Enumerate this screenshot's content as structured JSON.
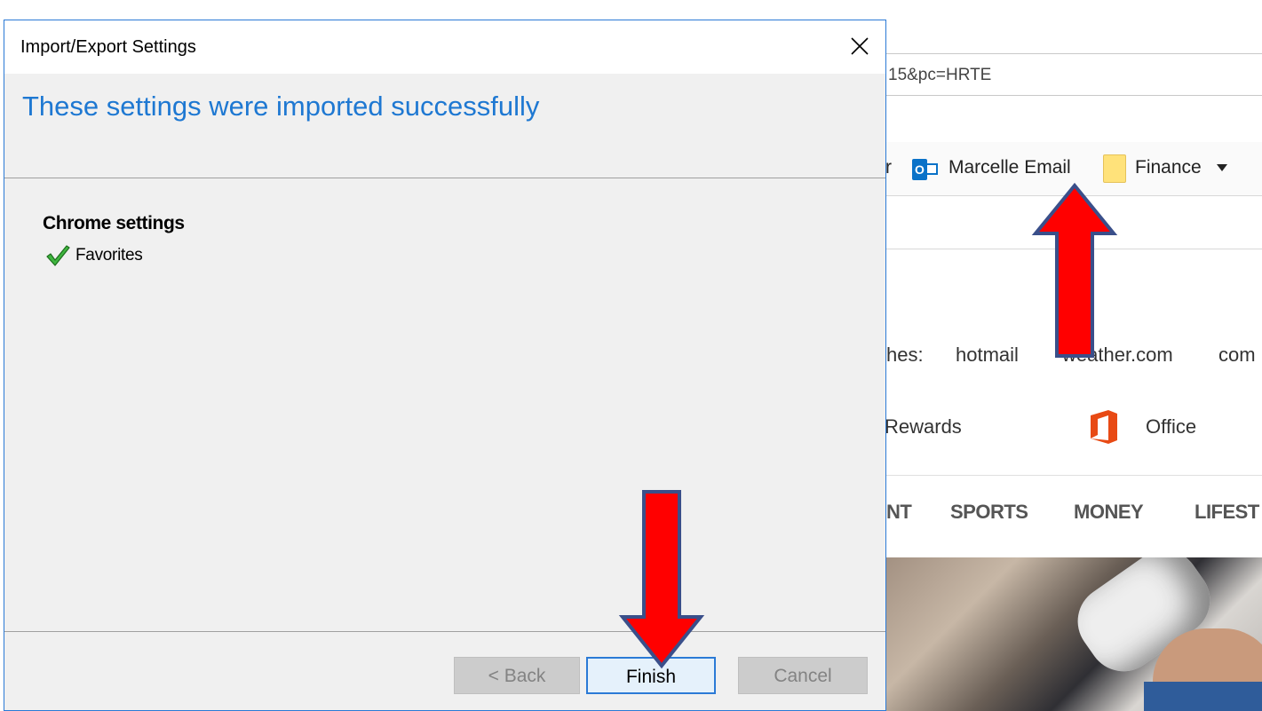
{
  "browser": {
    "address_fragment": "15&pc=HRTE",
    "favorites": {
      "partial_left": "r",
      "email_label": "Marcelle Email",
      "finance_label": "Finance"
    },
    "trending": {
      "partial_label": "hes:",
      "items": [
        "hotmail",
        "weather.com",
        "com"
      ]
    },
    "links": {
      "rewards_label": "Rewards",
      "office_label": "Office"
    },
    "nav": {
      "partial": "NT",
      "sports": "SPORTS",
      "money": "MONEY",
      "lifestyle_partial": "LIFEST"
    }
  },
  "dialog": {
    "title": "Import/Export Settings",
    "heading": "These settings were imported successfully",
    "section_title": "Chrome settings",
    "items": [
      {
        "label": "Favorites",
        "status": "imported"
      }
    ],
    "buttons": {
      "back": "< Back",
      "finish": "Finish",
      "cancel": "Cancel"
    }
  },
  "colors": {
    "heading_blue": "#1e78d2",
    "dialog_border": "#2b7ad6",
    "arrow_red": "#ff0000",
    "arrow_outline": "#3a4f8a",
    "check_green": "#2e9e2e"
  },
  "icons": {
    "close": "close-icon",
    "check": "checkmark-icon",
    "outlook": "outlook-icon",
    "folder": "folder-icon",
    "office": "office-icon"
  }
}
